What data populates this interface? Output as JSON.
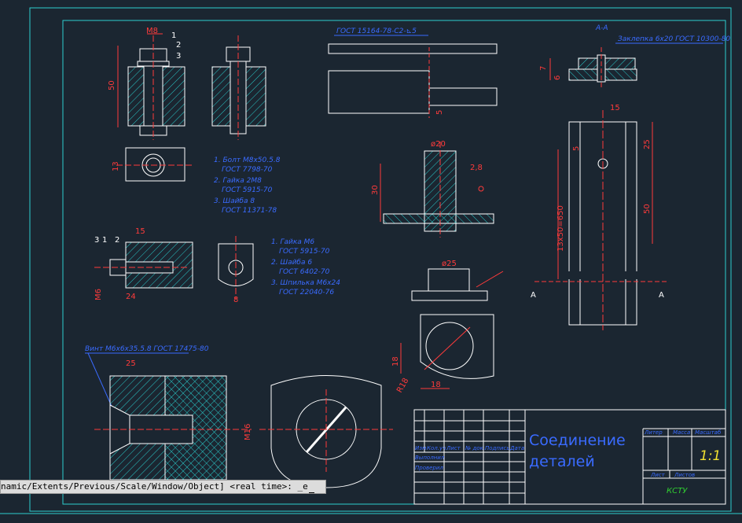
{
  "drawing": {
    "gost_weld": "ГОСТ 15164-78-С2-⊾5",
    "section_label": "А-А",
    "rivet_label": "Заклепка 6х20 ГОСТ 10300-80",
    "screw_label": "Винт М6х6хЗ5.5.8 ГОСТ 17475-80",
    "dims": {
      "m8": "М8",
      "d50": "50",
      "d13": "13",
      "d15a": "15",
      "d24": "24",
      "m6": "М6",
      "d8": "8",
      "d25a": "25",
      "m16": "М16",
      "d20": "ø20",
      "d28": "2,8",
      "d30": "30",
      "d5a": "5",
      "d25b": "ø25",
      "d18a": "18",
      "d18b": "18",
      "r18": "R18",
      "d15b": "15",
      "d25c": "25",
      "d50b": "50",
      "d650": "13х50=650",
      "d7": "7",
      "d6": "6",
      "d5b": "5",
      "sec_a1": "А",
      "sec_a2": "А",
      "c1": "1",
      "c2": "2",
      "c3": "3",
      "c31": "3",
      "c11": "1",
      "c21": "2"
    },
    "spec1": [
      "1. Болт М8х50.5.8",
      "ГОСТ 7798-70",
      "2. Гайка 2М8",
      "ГОСТ 5915-70",
      "3. Шайба 8",
      "ГОСТ 11371-78"
    ],
    "spec2": [
      "1. Гайка М6",
      "ГОСТ 5915-70",
      "2. Шайба 6",
      "ГОСТ 6402-70",
      "3. Шпилька М6х24",
      "ГОСТ 22040-76"
    ]
  },
  "title_block": {
    "title_line1": "Соединение",
    "title_line2": "деталей",
    "col_headers": [
      "Изм",
      "Кол.уч",
      "Лист",
      "№ док.",
      "Подпись",
      "Дата"
    ],
    "row_executed": "Выполнил",
    "row_checked": "Проверил",
    "litera": "Литер",
    "massa": "Масса",
    "masshtab": "Масштаб",
    "scale": "1:1",
    "list": "Лист",
    "listov": "Листов",
    "org": "КСТУ"
  },
  "command_line": {
    "text": "namic/Extents/Previous/Scale/Window/Object] <real time>: _e"
  },
  "colors": {
    "background": "#1b2631",
    "frame": "#2ccfcf",
    "lines": "#ffffff",
    "dims": "#ff3b3b",
    "text": "#3a6bff",
    "hatch": "#2ac9c9",
    "scale": "#f0e030",
    "org": "#30d030"
  }
}
